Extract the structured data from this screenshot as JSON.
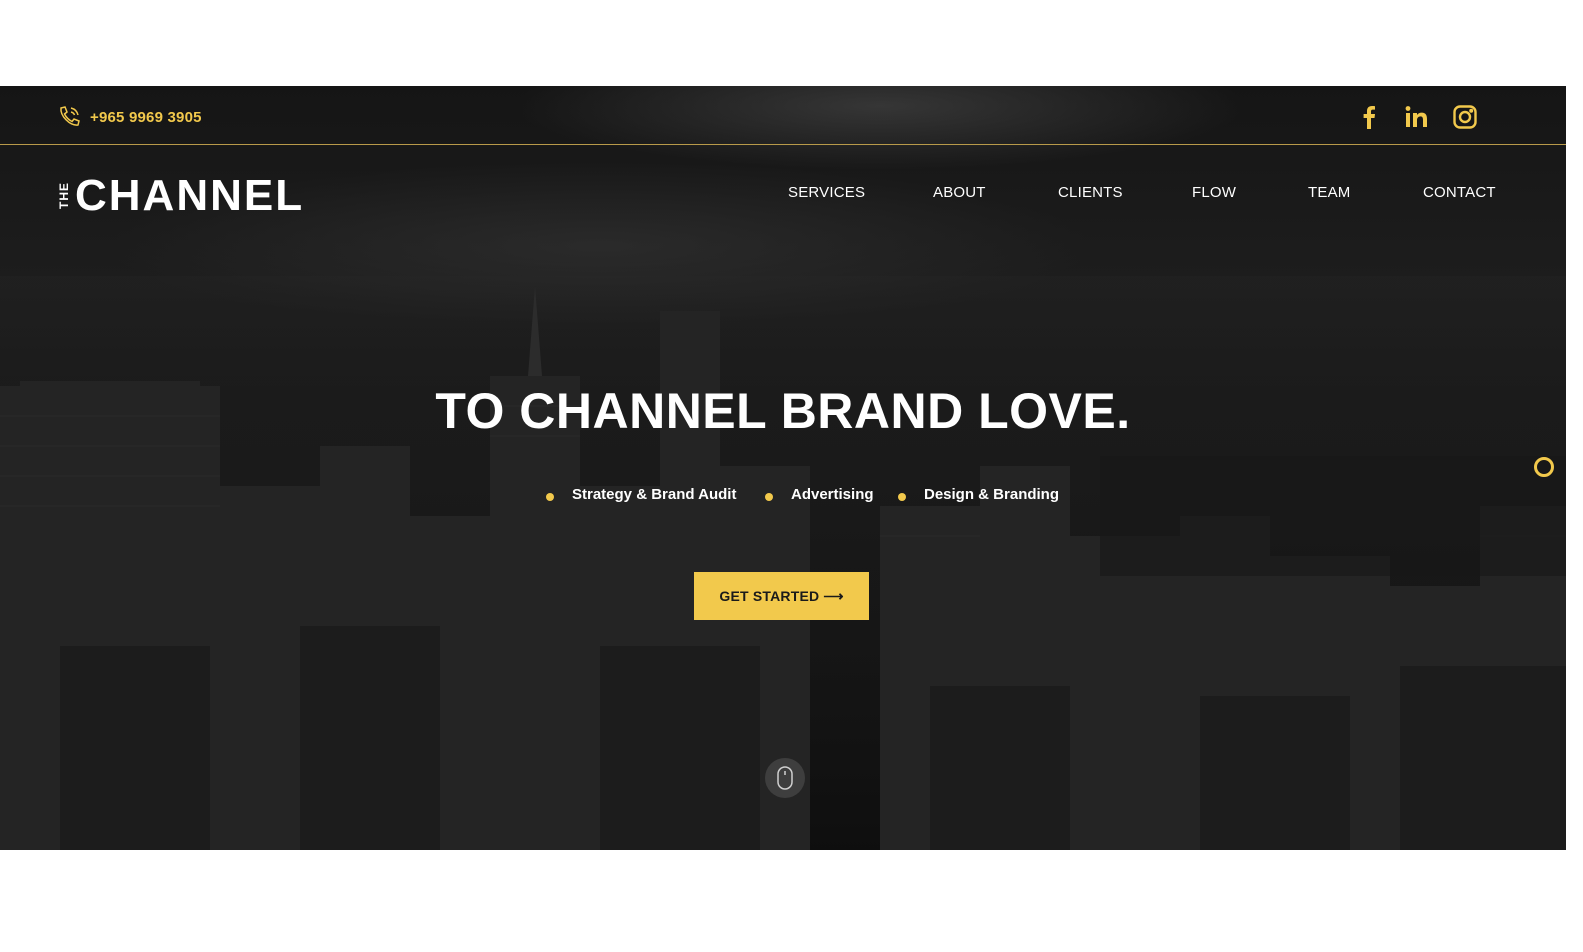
{
  "topbar": {
    "phone": "+965 9969 3905",
    "phone_icon": "phone-icon",
    "social": [
      {
        "name": "facebook-icon"
      },
      {
        "name": "linkedin-icon"
      },
      {
        "name": "instagram-icon"
      }
    ]
  },
  "logo": {
    "prefix": "THE",
    "word": "CHANNEL"
  },
  "nav": {
    "items": [
      "SERVICES",
      "ABOUT",
      "CLIENTS",
      "FLOW",
      "TEAM",
      "CONTACT"
    ]
  },
  "hero": {
    "headline": "TO CHANNEL BRAND LOVE.",
    "services": [
      "Strategy & Brand Audit",
      "Advertising",
      "Design & Branding"
    ],
    "cta_label": "GET STARTED",
    "cta_arrow": "⟶",
    "scroll_icon": "mouse-scroll-icon",
    "side_indicator": "circle-indicator-icon"
  },
  "colors": {
    "accent": "#f2c94c",
    "background": "#151515",
    "text": "#ffffff"
  }
}
